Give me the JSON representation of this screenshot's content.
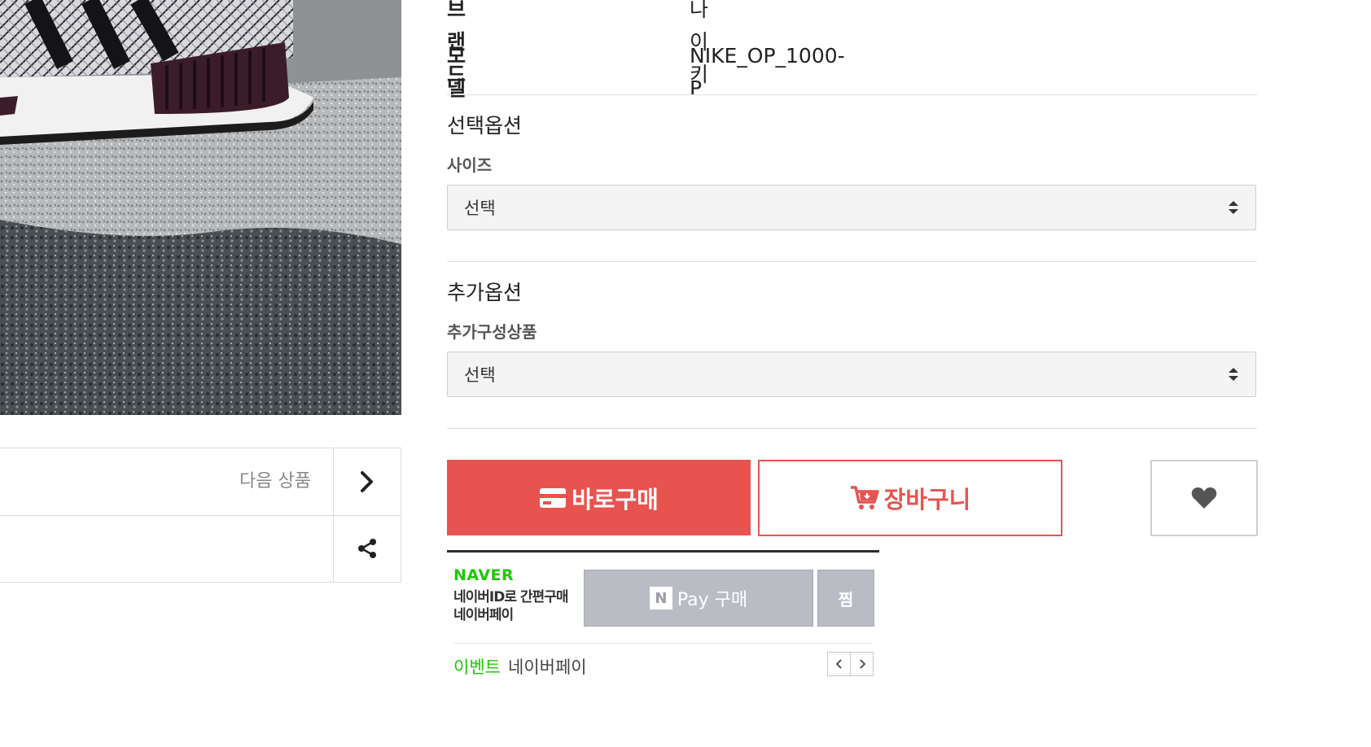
{
  "product_info": {
    "brand_label": "브랜드",
    "brand_value": "나이키",
    "model_label": "모델",
    "model_value": "NIKE_OP_1000-P"
  },
  "nav": {
    "next_label": "다음 상품"
  },
  "options": {
    "select_title": "선택옵션",
    "size_label": "사이즈",
    "size_value": "선택",
    "extra_title": "추가옵션",
    "extra_label": "추가구성상품",
    "extra_value": "선택"
  },
  "actions": {
    "buy_label": "바로구매",
    "cart_label": "장바구니",
    "accent_color": "#e8534f"
  },
  "naver_pay": {
    "logo": "NAVER",
    "desc_line1": "네이버ID로 간편구매",
    "desc_line2": "네이버페이",
    "n_mark": "N",
    "pay_label": "Pay 구매",
    "zzim_label": "찜",
    "event_tag": "이벤트",
    "event_text": "네이버페이",
    "brand_color": "#1ec800"
  },
  "icons": {
    "next": "chevron-right-icon",
    "share": "share-icon",
    "buy": "credit-card-icon",
    "cart": "cart-icon",
    "wish": "heart-icon"
  }
}
